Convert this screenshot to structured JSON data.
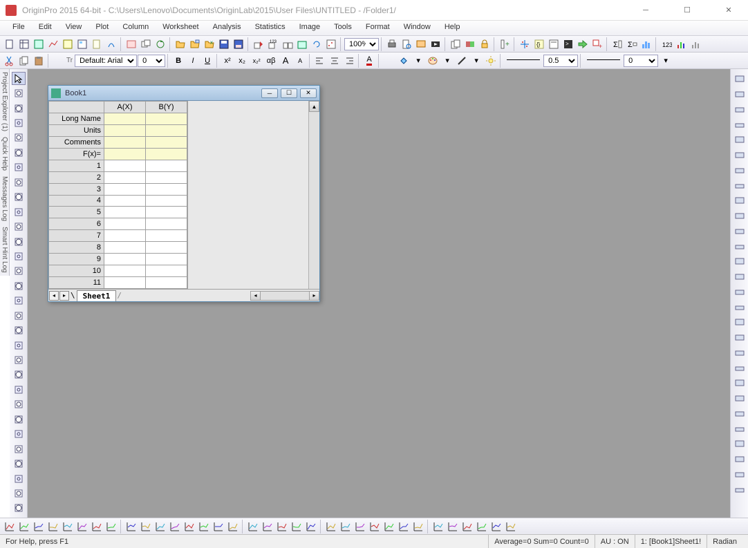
{
  "title": "OriginPro 2015 64-bit - C:\\Users\\Lenovo\\Documents\\OriginLab\\2015\\User Files\\UNTITLED - /Folder1/",
  "menu": [
    "File",
    "Edit",
    "View",
    "Plot",
    "Column",
    "Worksheet",
    "Analysis",
    "Statistics",
    "Image",
    "Tools",
    "Format",
    "Window",
    "Help"
  ],
  "font": {
    "family": "Default: Arial",
    "size": "0"
  },
  "zoom": "100%",
  "lineWidth": "0.5",
  "arrowSize": "0",
  "child": {
    "title": "Book1",
    "columns": [
      "A(X)",
      "B(Y)"
    ],
    "metaRows": [
      "Long Name",
      "Units",
      "Comments",
      "F(x)="
    ],
    "rows": [
      1,
      2,
      3,
      4,
      5,
      6,
      7,
      8,
      9,
      10,
      11
    ],
    "sheetTab": "Sheet1"
  },
  "status": {
    "help": "For Help, press F1",
    "stats": "Average=0 Sum=0 Count=0",
    "au": "AU : ON",
    "loc": "1: [Book1]Sheet1!",
    "angle": "Radian"
  },
  "leftPanels": [
    "Project Explorer (1)",
    "Quick Help",
    "Messages Log",
    "Smart Hint Log"
  ]
}
